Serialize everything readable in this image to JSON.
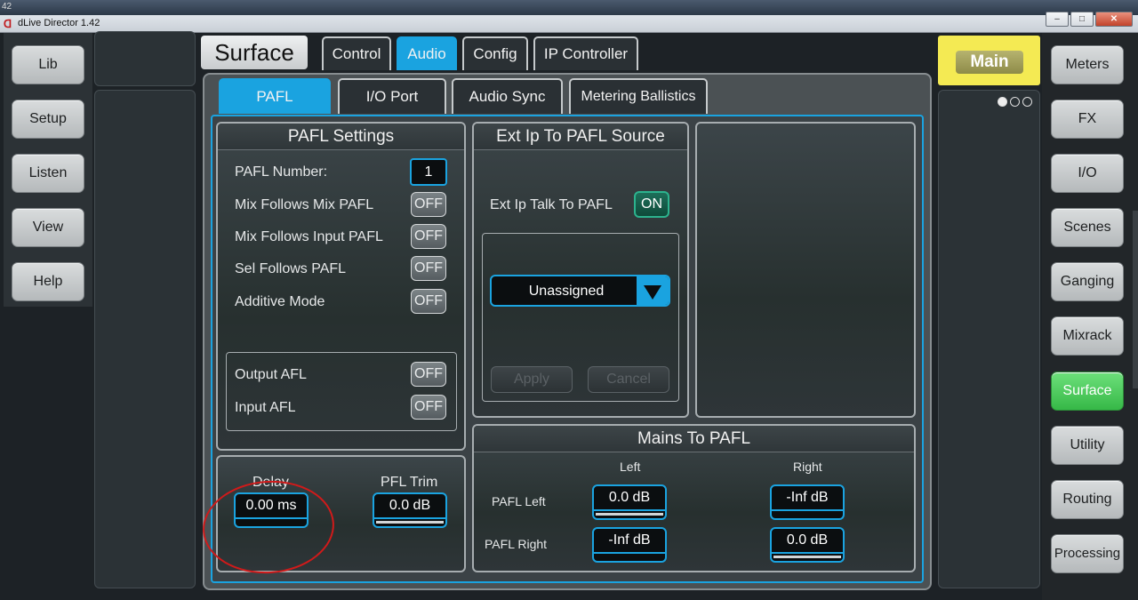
{
  "window": {
    "title": "dLive Director 1.42",
    "version_corner": "42",
    "btn_min": "–",
    "btn_max": "□",
    "btn_close": "✕"
  },
  "left_nav": [
    {
      "label": "Lib"
    },
    {
      "label": "Setup"
    },
    {
      "label": "Listen"
    },
    {
      "label": "View"
    },
    {
      "label": "Help"
    }
  ],
  "right_nav": [
    {
      "label": "Meters"
    },
    {
      "label": "FX"
    },
    {
      "label": "I/O"
    },
    {
      "label": "Scenes"
    },
    {
      "label": "Ganging"
    },
    {
      "label": "Mixrack"
    },
    {
      "label": "Surface",
      "active": true
    },
    {
      "label": "Utility"
    },
    {
      "label": "Routing"
    },
    {
      "label": "Processing"
    }
  ],
  "header": {
    "page_title": "Surface",
    "tabs": [
      {
        "label": "Control"
      },
      {
        "label": "Audio",
        "active": true
      },
      {
        "label": "Config"
      },
      {
        "label": "IP Controller"
      }
    ],
    "main_button": "Main"
  },
  "sub_tabs": [
    {
      "label": "PAFL",
      "active": true
    },
    {
      "label": "I/O Port"
    },
    {
      "label": "Audio Sync"
    },
    {
      "label": "Metering Ballistics"
    }
  ],
  "pafl_settings": {
    "title": "PAFL Settings",
    "pafl_number_label": "PAFL Number:",
    "pafl_number": "1",
    "rows": [
      {
        "label": "Mix Follows Mix PAFL",
        "state": "OFF"
      },
      {
        "label": "Mix Follows Input PAFL",
        "state": "OFF"
      },
      {
        "label": "Sel Follows PAFL",
        "state": "OFF"
      },
      {
        "label": "Additive Mode",
        "state": "OFF"
      }
    ],
    "afl": [
      {
        "label": "Output AFL",
        "state": "OFF"
      },
      {
        "label": "Input AFL",
        "state": "OFF"
      }
    ],
    "delay": {
      "label": "Delay",
      "value": "0.00 ms",
      "level": 0.0
    },
    "pfl_trim": {
      "label": "PFL Trim",
      "value": "0.0 dB",
      "level": 1.0
    }
  },
  "ext_ip": {
    "title": "Ext Ip To PAFL Source",
    "talk_label": "Ext Ip Talk To PAFL",
    "talk_state": "ON",
    "source": "Unassigned",
    "apply": "Apply",
    "cancel": "Cancel"
  },
  "mains_to_pafl": {
    "title": "Mains To PAFL",
    "col_left": "Left",
    "col_right": "Right",
    "row_left": "PAFL Left",
    "row_right": "PAFL Right",
    "pafl_left_left": {
      "value": "0.0 dB",
      "level": 1.0
    },
    "pafl_left_right": {
      "value": "-Inf dB",
      "level": 0.0
    },
    "pafl_right_left": {
      "value": "-Inf dB",
      "level": 0.0
    },
    "pafl_right_right": {
      "value": "0.0 dB",
      "level": 1.0
    }
  }
}
